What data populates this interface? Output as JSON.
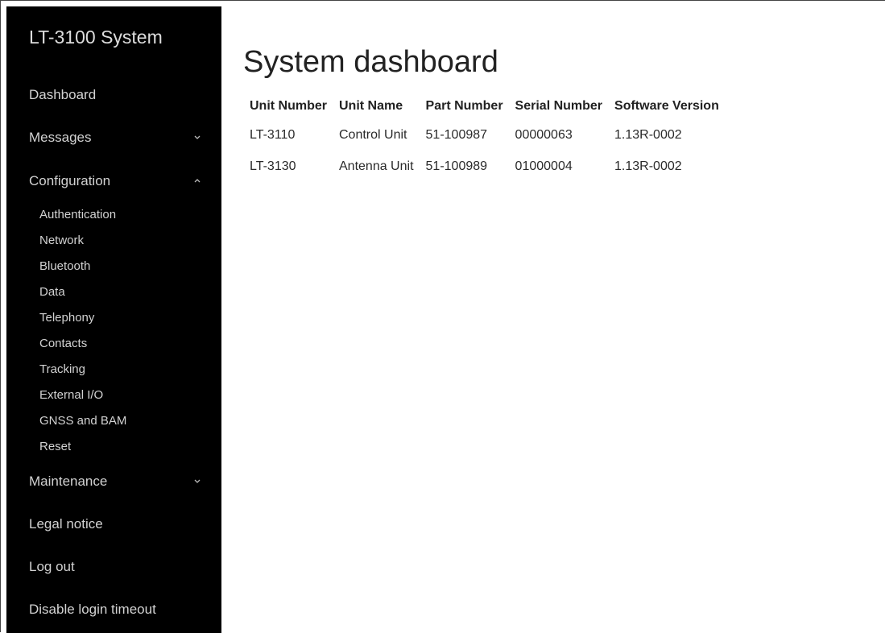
{
  "sidebar": {
    "brand": "LT-3100 System",
    "items": [
      {
        "label": "Dashboard"
      },
      {
        "label": "Messages",
        "chevron": "chevron-down-icon"
      },
      {
        "label": "Configuration",
        "chevron": "chevron-up-icon"
      },
      {
        "label": "Maintenance",
        "chevron": "chevron-down-icon"
      },
      {
        "label": "Legal notice"
      },
      {
        "label": "Log out"
      },
      {
        "label": "Disable login timeout"
      }
    ],
    "configuration_subitems": [
      "Authentication",
      "Network",
      "Bluetooth",
      "Data",
      "Telephony",
      "Contacts",
      "Tracking",
      "External I/O",
      "GNSS and BAM",
      "Reset"
    ]
  },
  "main": {
    "title": "System dashboard",
    "table": {
      "headers": [
        "Unit Number",
        "Unit Name",
        "Part Number",
        "Serial Number",
        "Software Version"
      ],
      "rows": [
        [
          "LT-3110",
          "Control Unit",
          "51-100987",
          "00000063",
          "1.13R-0002"
        ],
        [
          "LT-3130",
          "Antenna Unit",
          "51-100989",
          "01000004",
          "1.13R-0002"
        ]
      ]
    }
  },
  "colors": {
    "sidebar_bg": "#000000",
    "sidebar_text": "#d2d2d2",
    "main_bg": "#ffffff",
    "text": "#222222"
  }
}
